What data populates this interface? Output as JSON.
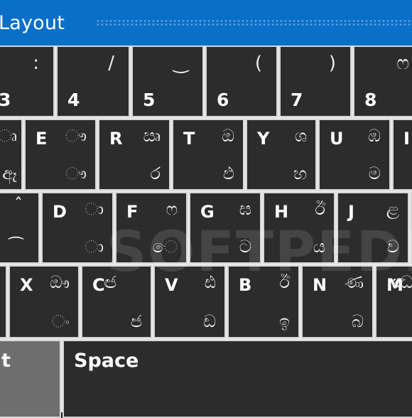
{
  "window": {
    "title": "Layout"
  },
  "watermark": "SOFTPEDIA",
  "rows": {
    "number": [
      {
        "digit": "3",
        "sym": ":"
      },
      {
        "digit": "4",
        "sym": "/"
      },
      {
        "digit": "5",
        "sym": "‿"
      },
      {
        "digit": "6",
        "sym": "("
      },
      {
        "digit": "7",
        "sym": ")"
      },
      {
        "digit": "8",
        "sym": "ෆ"
      }
    ],
    "qwerty": [
      {
        "letter": "",
        "upper": "ෘ",
        "lower": "ඈ"
      },
      {
        "letter": "E",
        "upper": "ෟ",
        "lower": "ෟ"
      },
      {
        "letter": "R",
        "upper": "ඍ",
        "lower": "ර"
      },
      {
        "letter": "T",
        "upper": "ඔ",
        "lower": "ඵ"
      },
      {
        "letter": "Y",
        "upper": "ශ",
        "lower": "හ"
      },
      {
        "letter": "U",
        "upper": "ඹ",
        "lower": "ම"
      },
      {
        "letter": "I",
        "upper": "",
        "lower": ""
      }
    ],
    "asdf": [
      {
        "letter": "",
        "upper": "ˆ",
        "lower": "⁀"
      },
      {
        "letter": "D",
        "upper": "ා",
        "lower": "ා"
      },
      {
        "letter": "F",
        "upper": "ෆ",
        "lower": "ෙ"
      },
      {
        "letter": "G",
        "upper": "ඝ",
        "lower": "ට"
      },
      {
        "letter": "H",
        "upper": "ඊ",
        "lower": "ය"
      },
      {
        "letter": "J",
        "upper": "ළ",
        "lower": "ව"
      }
    ],
    "zxcv": [
      {
        "letter": "X",
        "upper": "ඖ",
        "lower": "ං"
      },
      {
        "letter": "C",
        "upper": "ඦ",
        "lower": "ජ"
      },
      {
        "letter": "V",
        "upper": "ඪ",
        "lower": "ඩ"
      },
      {
        "letter": "B",
        "upper": "ඊ",
        "lower": "ඉ"
      },
      {
        "letter": "N",
        "upper": "ණ",
        "lower": "බ"
      },
      {
        "letter": "M",
        "upper": "ඣ",
        "lower": ""
      }
    ],
    "bottom": {
      "shift_partial": "t",
      "space": "Space"
    }
  }
}
